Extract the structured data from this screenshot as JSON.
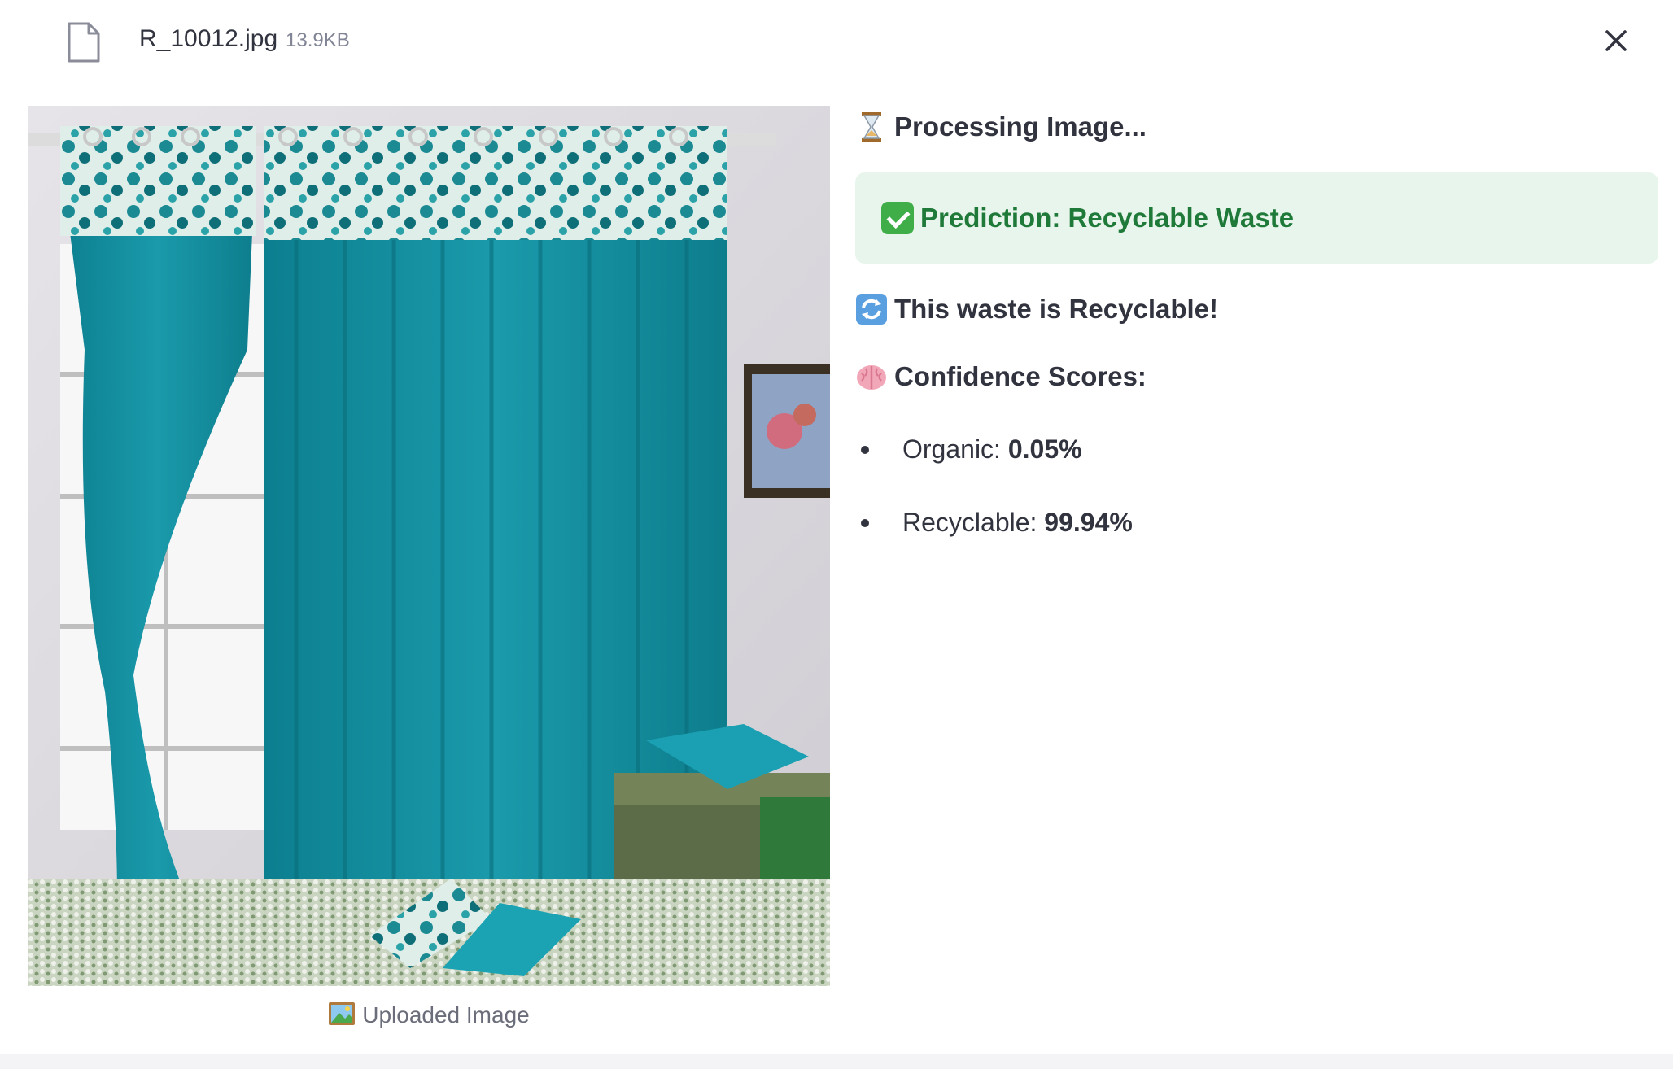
{
  "file": {
    "name": "R_10012.jpg",
    "size": "13.9KB",
    "icon": "file-icon",
    "close_icon": "close-icon"
  },
  "image": {
    "caption": "Uploaded Image",
    "caption_icon": "framed-picture-icon"
  },
  "result": {
    "processing": "Processing Image...",
    "processing_icon": "hourglass-icon",
    "prediction": "Prediction: Recyclable Waste",
    "prediction_icon": "check-mark-icon",
    "recyclable_message": "This waste is Recyclable!",
    "recyclable_icon": "recycle-arrows-icon",
    "confidence_heading": "Confidence Scores:",
    "confidence_icon": "brain-icon",
    "scores": [
      {
        "label": "Organic: ",
        "value": "0.05%"
      },
      {
        "label": "Recyclable: ",
        "value": "99.94%"
      }
    ]
  },
  "colors": {
    "success_bg": "#e8f5ec",
    "success_text": "#1f7a3a",
    "text": "#31333f",
    "muted": "#808495"
  }
}
